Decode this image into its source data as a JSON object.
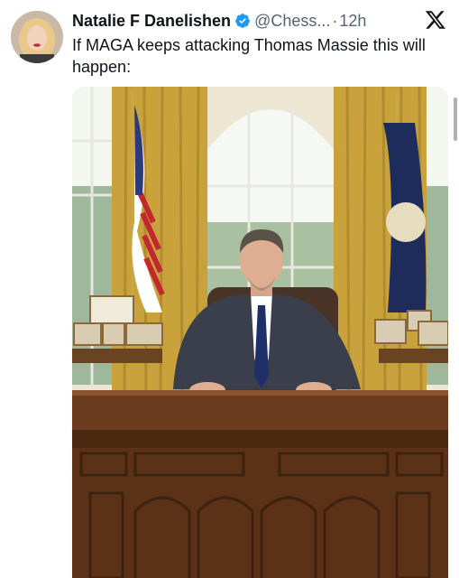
{
  "tweet": {
    "author_name": "Natalie F Danelishen",
    "handle": "@Chess...",
    "separator": "·",
    "time": "12h",
    "text": "If MAGA keeps attacking Thomas Massie this will happen:"
  },
  "icons": {
    "verified": "verified-badge-icon",
    "platform": "x-logo-icon"
  },
  "colors": {
    "verified_blue": "#1d9bf0",
    "secondary_text": "#536471",
    "primary_text": "#0f1419"
  }
}
